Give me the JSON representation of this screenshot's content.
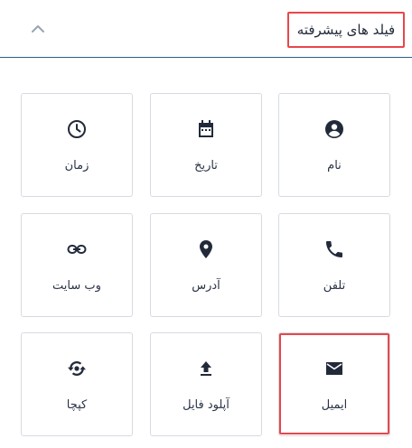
{
  "section": {
    "title": "فیلد های پیشرفته",
    "collapse_icon": "chevron-up-icon"
  },
  "colors": {
    "highlight": "#e8474a",
    "divider": "#2c5f85",
    "icon": "#222a3a",
    "tile_border": "#d6dae3"
  },
  "fields": [
    {
      "label": "نام",
      "icon": "account-circle-icon"
    },
    {
      "label": "تاریخ",
      "icon": "calendar-icon"
    },
    {
      "label": "زمان",
      "icon": "clock-icon"
    },
    {
      "label": "تلفن",
      "icon": "phone-icon"
    },
    {
      "label": "آدرس",
      "icon": "map-pin-icon"
    },
    {
      "label": "وب سایت",
      "icon": "link-icon"
    },
    {
      "label": "ایمیل",
      "icon": "envelope-icon"
    },
    {
      "label": "آپلود فایل",
      "icon": "upload-icon"
    },
    {
      "label": "کپچا",
      "icon": "captcha-refresh-icon"
    }
  ]
}
